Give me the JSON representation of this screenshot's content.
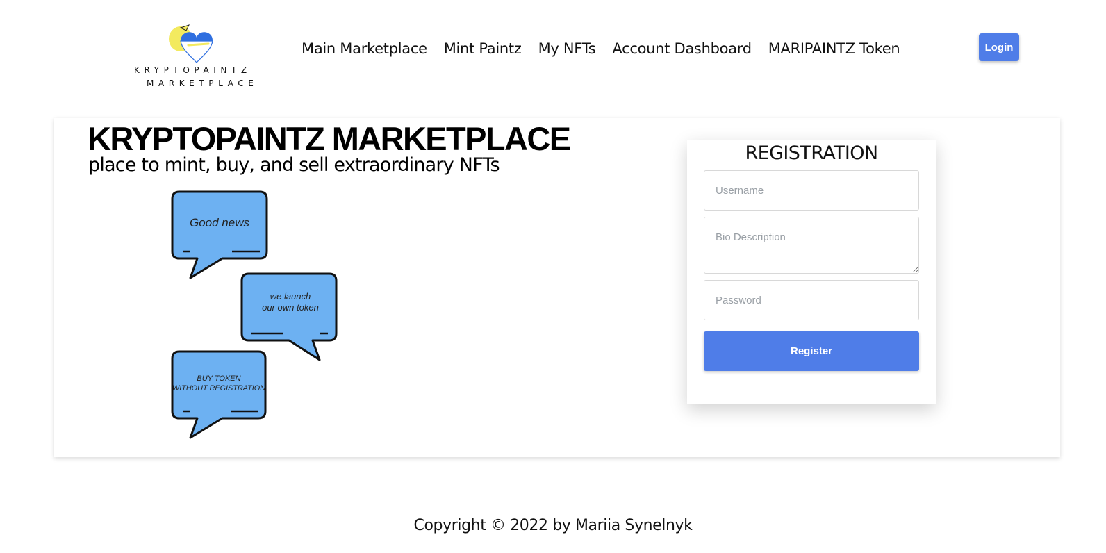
{
  "header": {
    "logo": {
      "line1": "KRYPTOPAINTZ",
      "line2": "MARKETPLACE"
    },
    "nav": [
      {
        "label": "Main Marketplace"
      },
      {
        "label": "Mint Paintz"
      },
      {
        "label": "My NFTs"
      },
      {
        "label": "Account Dashboard"
      },
      {
        "label": "MARIPAINTZ Token"
      }
    ],
    "login_label": "Login"
  },
  "hero": {
    "title": "KRYPTOPAINTZ MARKETPLACE",
    "subtitle": "place to mint, buy, and sell extraordinary NFTs",
    "bubbles": [
      {
        "text": "Good news"
      },
      {
        "line1": "we launch",
        "line2": "our own token"
      },
      {
        "line1": "BUY TOKEN",
        "line2": "WITHOUT REGISTRATION"
      }
    ]
  },
  "registration": {
    "title": "REGISTRATION",
    "username_placeholder": "Username",
    "bio_placeholder": "Bio Description",
    "password_placeholder": "Password",
    "submit_label": "Register"
  },
  "footer": {
    "copyright": "Copyright © 2022 by Mariia Synelnyk"
  },
  "colors": {
    "accent": "#4f7de8",
    "bubble_fill": "#6db1f2",
    "heart_blue": "#2f6fe0",
    "heart_yellow": "#f3ea5f"
  },
  "icons": {
    "logo": "heart-logo-icon"
  }
}
